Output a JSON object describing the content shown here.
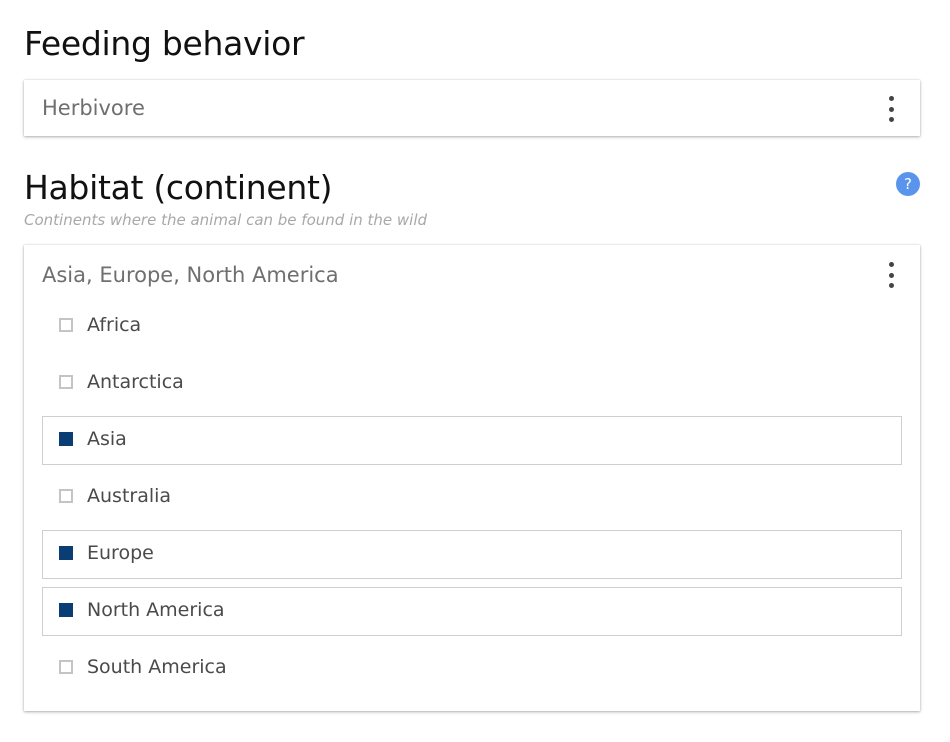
{
  "feeding": {
    "title": "Feeding behavior",
    "value": "Herbivore"
  },
  "habitat": {
    "title": "Habitat (continent)",
    "subtitle": "Continents where the animal can be found in the wild",
    "help_icon": "?",
    "value": "Asia, Europe, North America",
    "options": [
      {
        "label": "Africa",
        "checked": false
      },
      {
        "label": "Antarctica",
        "checked": false
      },
      {
        "label": "Asia",
        "checked": true
      },
      {
        "label": "Australia",
        "checked": false
      },
      {
        "label": "Europe",
        "checked": true
      },
      {
        "label": "North America",
        "checked": true
      },
      {
        "label": "South America",
        "checked": false
      }
    ]
  },
  "colors": {
    "checked": "#0a3d73",
    "help": "#5b94ec"
  },
  "icons": {
    "menu": "more-vertical-icon",
    "help": "help-icon"
  }
}
